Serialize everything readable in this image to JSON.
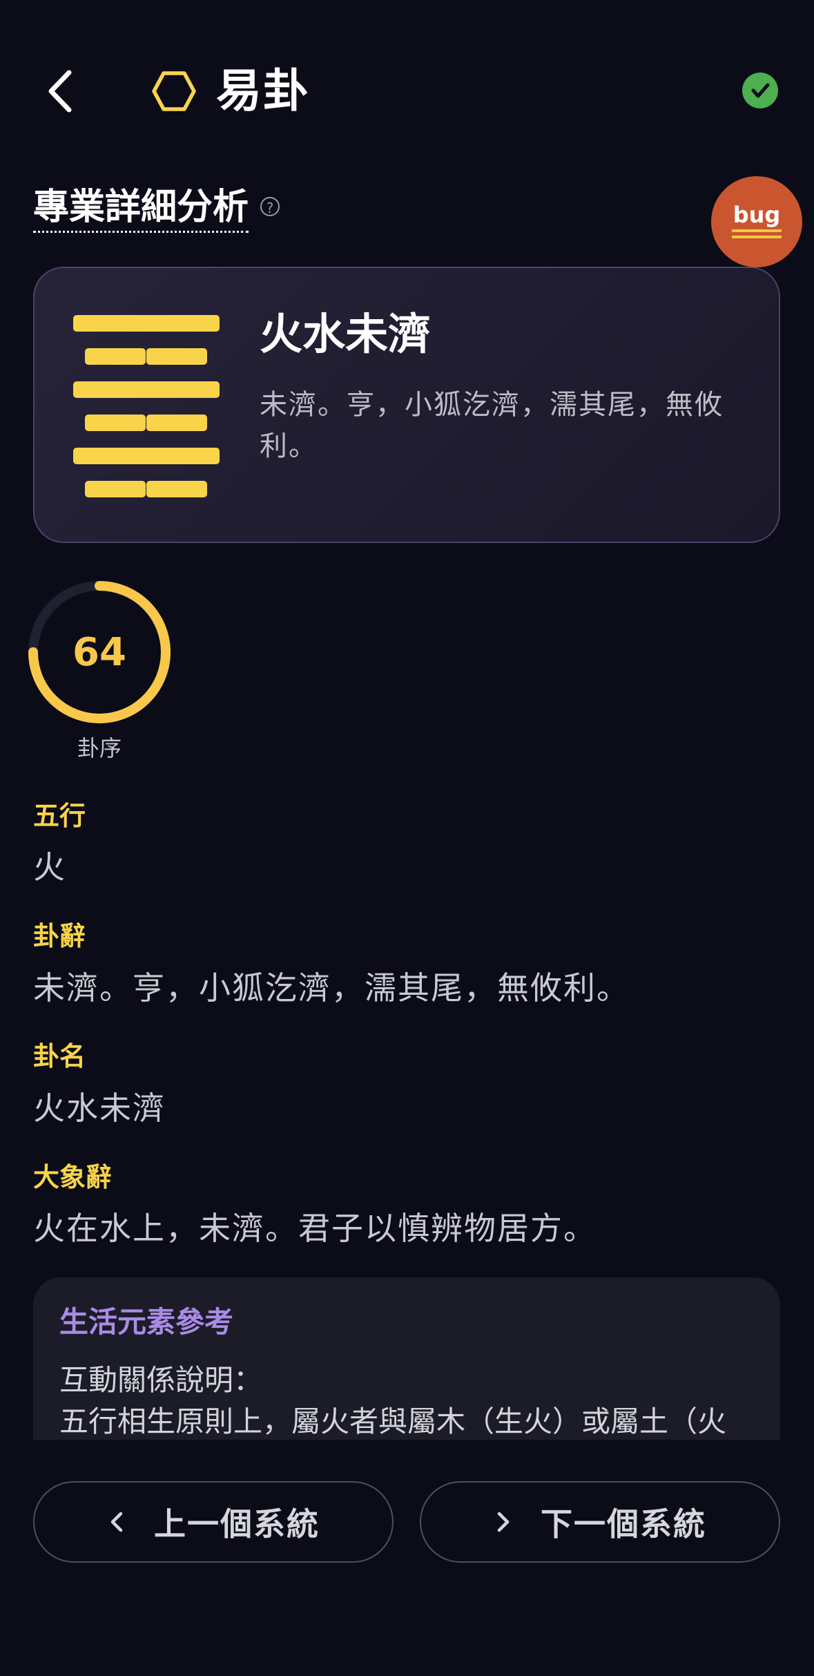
{
  "header": {
    "app_title": "易卦",
    "back_icon": "chevron-left-icon",
    "logo_icon": "hexagon-outline-icon",
    "status_icon": "check-circle-icon"
  },
  "section": {
    "title": "專業詳細分析",
    "help_icon": "question-circle-icon"
  },
  "debug": {
    "badge_label": "bug"
  },
  "hexagram": {
    "name": "火水未濟",
    "judgment": "未濟。亨，小狐汔濟，濡其尾，無攸利。",
    "lines_top_to_bottom": [
      "yang",
      "yin",
      "yang",
      "yin",
      "yang",
      "yin"
    ]
  },
  "order": {
    "value": "64",
    "label": "卦序",
    "fraction_of_total": 1.0
  },
  "fields": {
    "element": {
      "label": "五行",
      "value": "火"
    },
    "judgment": {
      "label": "卦辭",
      "value": "未濟。亨，小狐汔濟，濡其尾，無攸利。"
    },
    "name": {
      "label": "卦名",
      "value": "火水未濟"
    },
    "image": {
      "label": "大象辭",
      "value": "火在水上，未濟。君子以慎辨物居方。"
    }
  },
  "reference": {
    "title": "生活元素參考",
    "subtitle": "互動關係說明：",
    "body": "五行相生原則上，屬火者與屬木（生火）或屬土（火"
  },
  "nav": {
    "prev_label": "上一個系統",
    "next_label": "下一個系統"
  },
  "colors": {
    "background": "#0b0c18",
    "accent_yellow": "#f9d44a",
    "accent_purple": "#a98be6",
    "badge_orange": "#c9562f",
    "success_green": "#4caf50"
  }
}
